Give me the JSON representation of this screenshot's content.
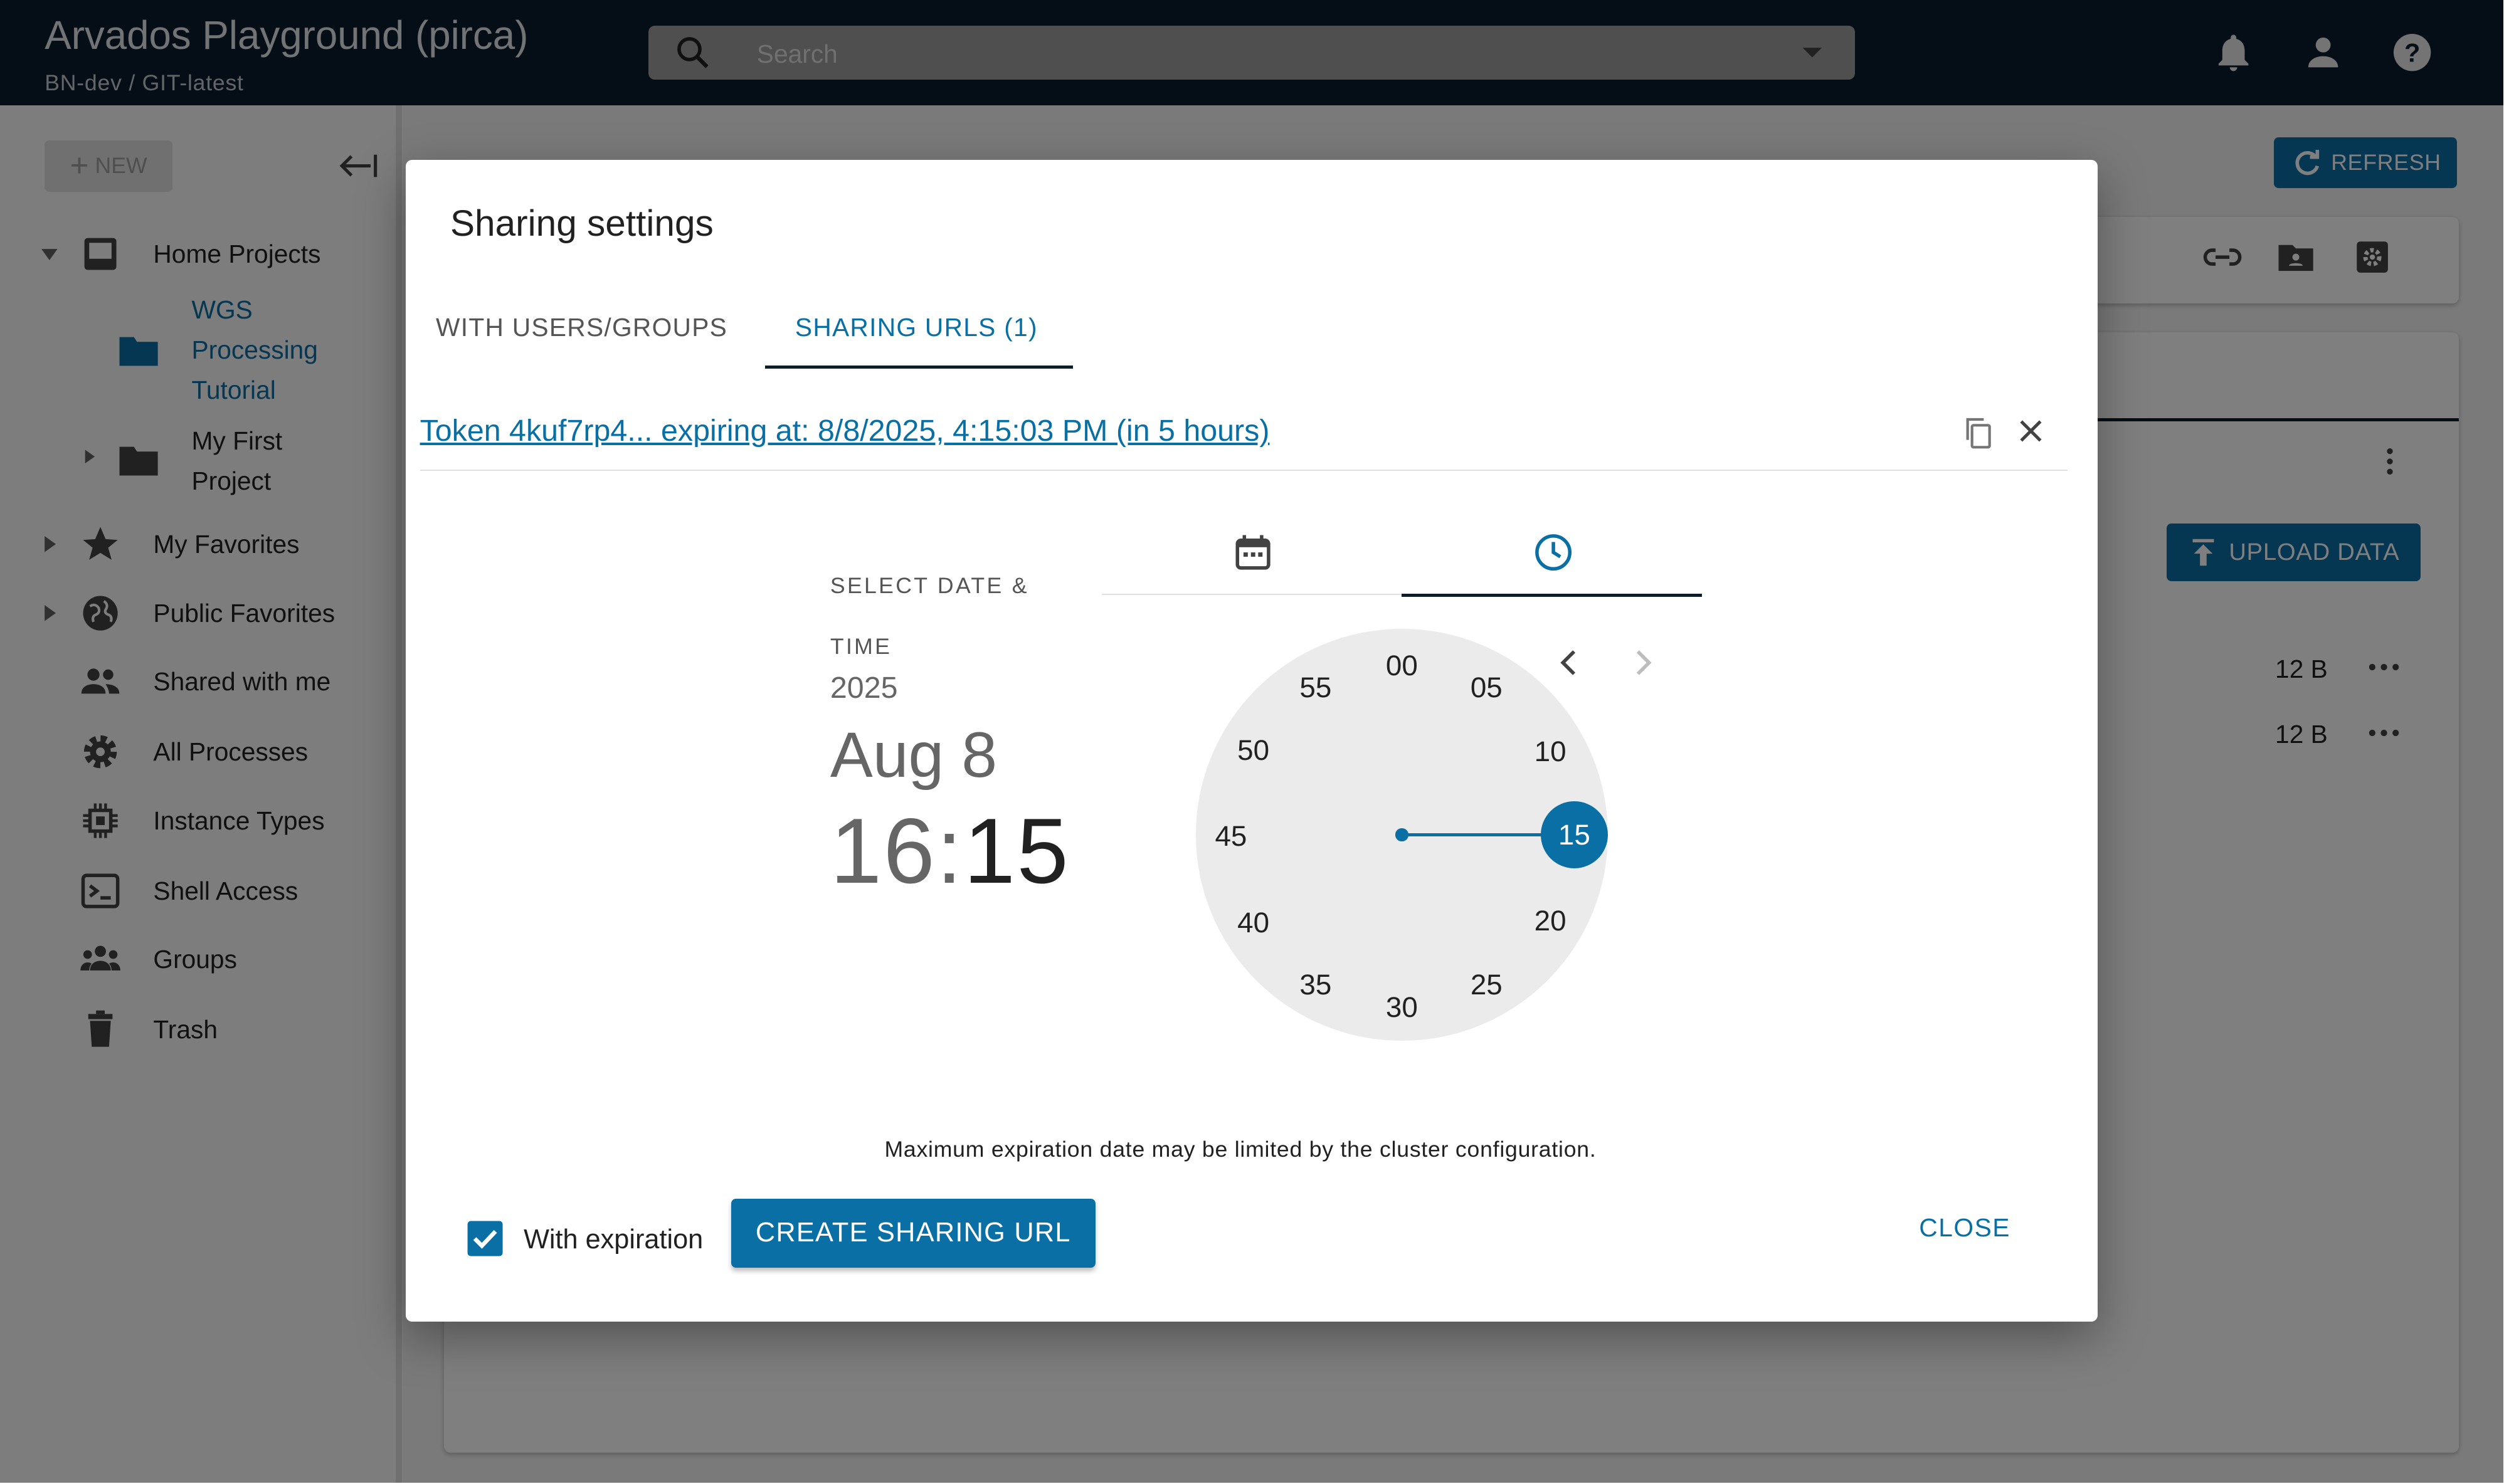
{
  "app": {
    "title": "Arvados Playground (pirca)",
    "subtitle": "BN-dev / GIT-latest"
  },
  "search": {
    "placeholder": "Search"
  },
  "sidebar": {
    "new_label": "NEW",
    "items": [
      {
        "label": "Home Projects",
        "icon": "inbox-icon"
      },
      {
        "label": "WGS Processing Tutorial",
        "icon": "folder-icon"
      },
      {
        "label": "My First Project",
        "icon": "folder-icon"
      },
      {
        "label": "My Favorites",
        "icon": "star-icon"
      },
      {
        "label": "Public Favorites",
        "icon": "globe-icon"
      },
      {
        "label": "Shared with me",
        "icon": "people-icon"
      },
      {
        "label": "All Processes",
        "icon": "gear-icon"
      },
      {
        "label": "Instance Types",
        "icon": "chip-icon"
      },
      {
        "label": "Shell Access",
        "icon": "terminal-icon"
      },
      {
        "label": "Groups",
        "icon": "groups-icon"
      },
      {
        "label": "Trash",
        "icon": "trash-icon"
      }
    ],
    "sub_lines": {
      "wgs": [
        "WGS",
        "Processing",
        "Tutorial"
      ],
      "first": [
        "My First",
        "Project"
      ]
    }
  },
  "background": {
    "refresh_label": "REFRESH",
    "upload_label": "UPLOAD DATA",
    "sizes": [
      "12 B",
      "12 B"
    ]
  },
  "dialog": {
    "title": "Sharing settings",
    "tabs": [
      {
        "label": "WITH USERS/GROUPS",
        "active": false
      },
      {
        "label": "SHARING URLS (1)",
        "active": true
      }
    ],
    "token_text": "Token 4kuf7rp4... expiring at: 8/8/2025, 4:15:03 PM (in 5 hours)",
    "picker": {
      "select_label": "SELECT DATE & TIME",
      "year": "2025",
      "date": "Aug 8",
      "hour": "16",
      "colon": ":",
      "minute": "15",
      "clock_numbers": [
        "00",
        "05",
        "10",
        "15",
        "20",
        "25",
        "30",
        "35",
        "40",
        "45",
        "50",
        "55"
      ],
      "selected_minute": "15"
    },
    "note": "Maximum expiration date may be limited by the cluster configuration.",
    "with_expiration_label": "With expiration",
    "with_expiration_checked": true,
    "create_label": "CREATE SHARING URL",
    "close_label": "CLOSE"
  },
  "colors": {
    "accent": "#0a6fa4",
    "topbar": "#0a1d2c"
  }
}
